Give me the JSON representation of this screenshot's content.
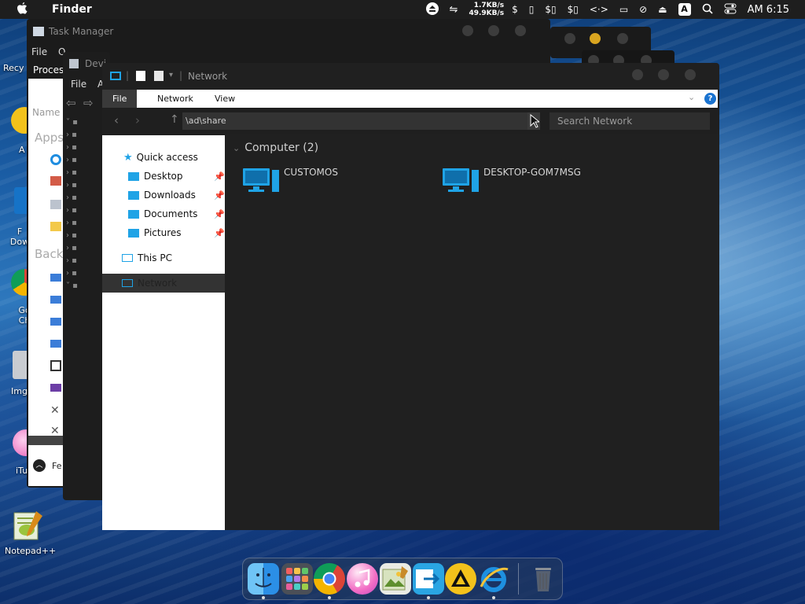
{
  "menubar": {
    "app_name": "Finder",
    "net_up": "1.7KB/s",
    "net_down": "49.9KB/s",
    "input_badge": "A",
    "clock": "AM 6:15"
  },
  "desktop": {
    "icons": [
      "Recy",
      "A",
      "F Dow",
      "Go Ch",
      "Img",
      "iTu",
      "Notepad++"
    ]
  },
  "task_manager": {
    "title": "Task Manager",
    "menu_file": "File",
    "menu_opt": "O",
    "tab": "Proces",
    "col_name": "Name",
    "section_apps": "Apps",
    "section_back": "Back",
    "footer": "Fe"
  },
  "device_manager": {
    "title": "Devi",
    "menu_file": "File",
    "menu_action": "A"
  },
  "explorer": {
    "title": "Network",
    "ribbon_tabs": [
      "File",
      "Network",
      "View"
    ],
    "address": "\\ad\\share",
    "search_placeholder": "Search Network",
    "nav": {
      "quick_access": "Quick access",
      "desktop": "Desktop",
      "downloads": "Downloads",
      "documents": "Documents",
      "pictures": "Pictures",
      "this_pc": "This PC",
      "network": "Network"
    },
    "group_header": "Computer (2)",
    "computers": [
      "CUSTOMOS",
      "DESKTOP-GOM7MSG"
    ]
  },
  "colors": {
    "accent_blue": "#1fa3e6",
    "window_dark": "#202020",
    "menubar": "#1e1e1e"
  },
  "dock": {
    "items": [
      "finder-icon",
      "launchpad-icon",
      "chrome-icon",
      "itunes-icon",
      "image-viewer-icon",
      "migration-icon",
      "ark-icon",
      "internet-explorer-icon",
      "trash-icon"
    ]
  }
}
